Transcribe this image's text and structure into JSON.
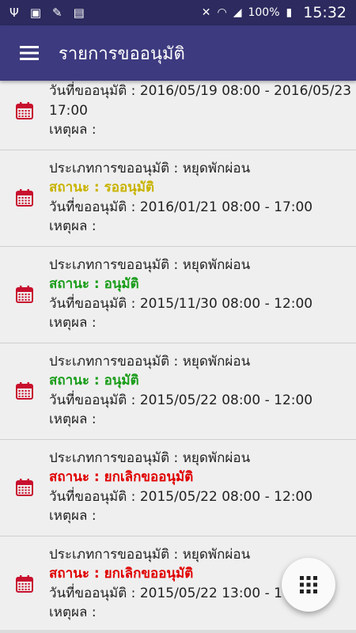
{
  "status_bar": {
    "battery": "100%",
    "time": "15:32"
  },
  "app_bar": {
    "title": "รายการขออนุมัติ"
  },
  "colors": {
    "pending": "#c9b300",
    "approved": "#1a9d1a",
    "cancelled": "#e00000",
    "icon": "#c8102e"
  },
  "items": [
    {
      "date_line": "วันที่ขออนุมัติ : 2016/05/19 08:00 - 2016/05/23 17:00",
      "reason": "เหตุผล :"
    },
    {
      "type": "ประเภทการขออนุมัติ : หยุดพักผ่อน",
      "status": "สถานะ : รออนุมัติ",
      "date_line": "วันที่ขออนุมัติ : 2016/01/21 08:00 - 17:00",
      "reason": "เหตุผล :"
    },
    {
      "type": "ประเภทการขออนุมัติ : หยุดพักผ่อน",
      "status": "สถานะ : อนุมัติ",
      "date_line": "วันที่ขออนุมัติ : 2015/11/30 08:00 - 12:00",
      "reason": "เหตุผล :"
    },
    {
      "type": "ประเภทการขออนุมัติ : หยุดพักผ่อน",
      "status": "สถานะ : อนุมัติ",
      "date_line": "วันที่ขออนุมัติ : 2015/05/22 08:00 - 12:00",
      "reason": "เหตุผล :"
    },
    {
      "type": "ประเภทการขออนุมัติ : หยุดพักผ่อน",
      "status": "สถานะ : ยกเลิกขออนุมัติ",
      "date_line": "วันที่ขออนุมัติ : 2015/05/22 08:00 - 12:00",
      "reason": "เหตุผล :"
    },
    {
      "type": "ประเภทการขออนุมัติ : หยุดพักผ่อน",
      "status": "สถานะ : ยกเลิกขออนุมัติ",
      "date_line": "วันที่ขออนุมัติ : 2015/05/22 13:00 - 17",
      "reason": "เหตุผล :"
    }
  ]
}
